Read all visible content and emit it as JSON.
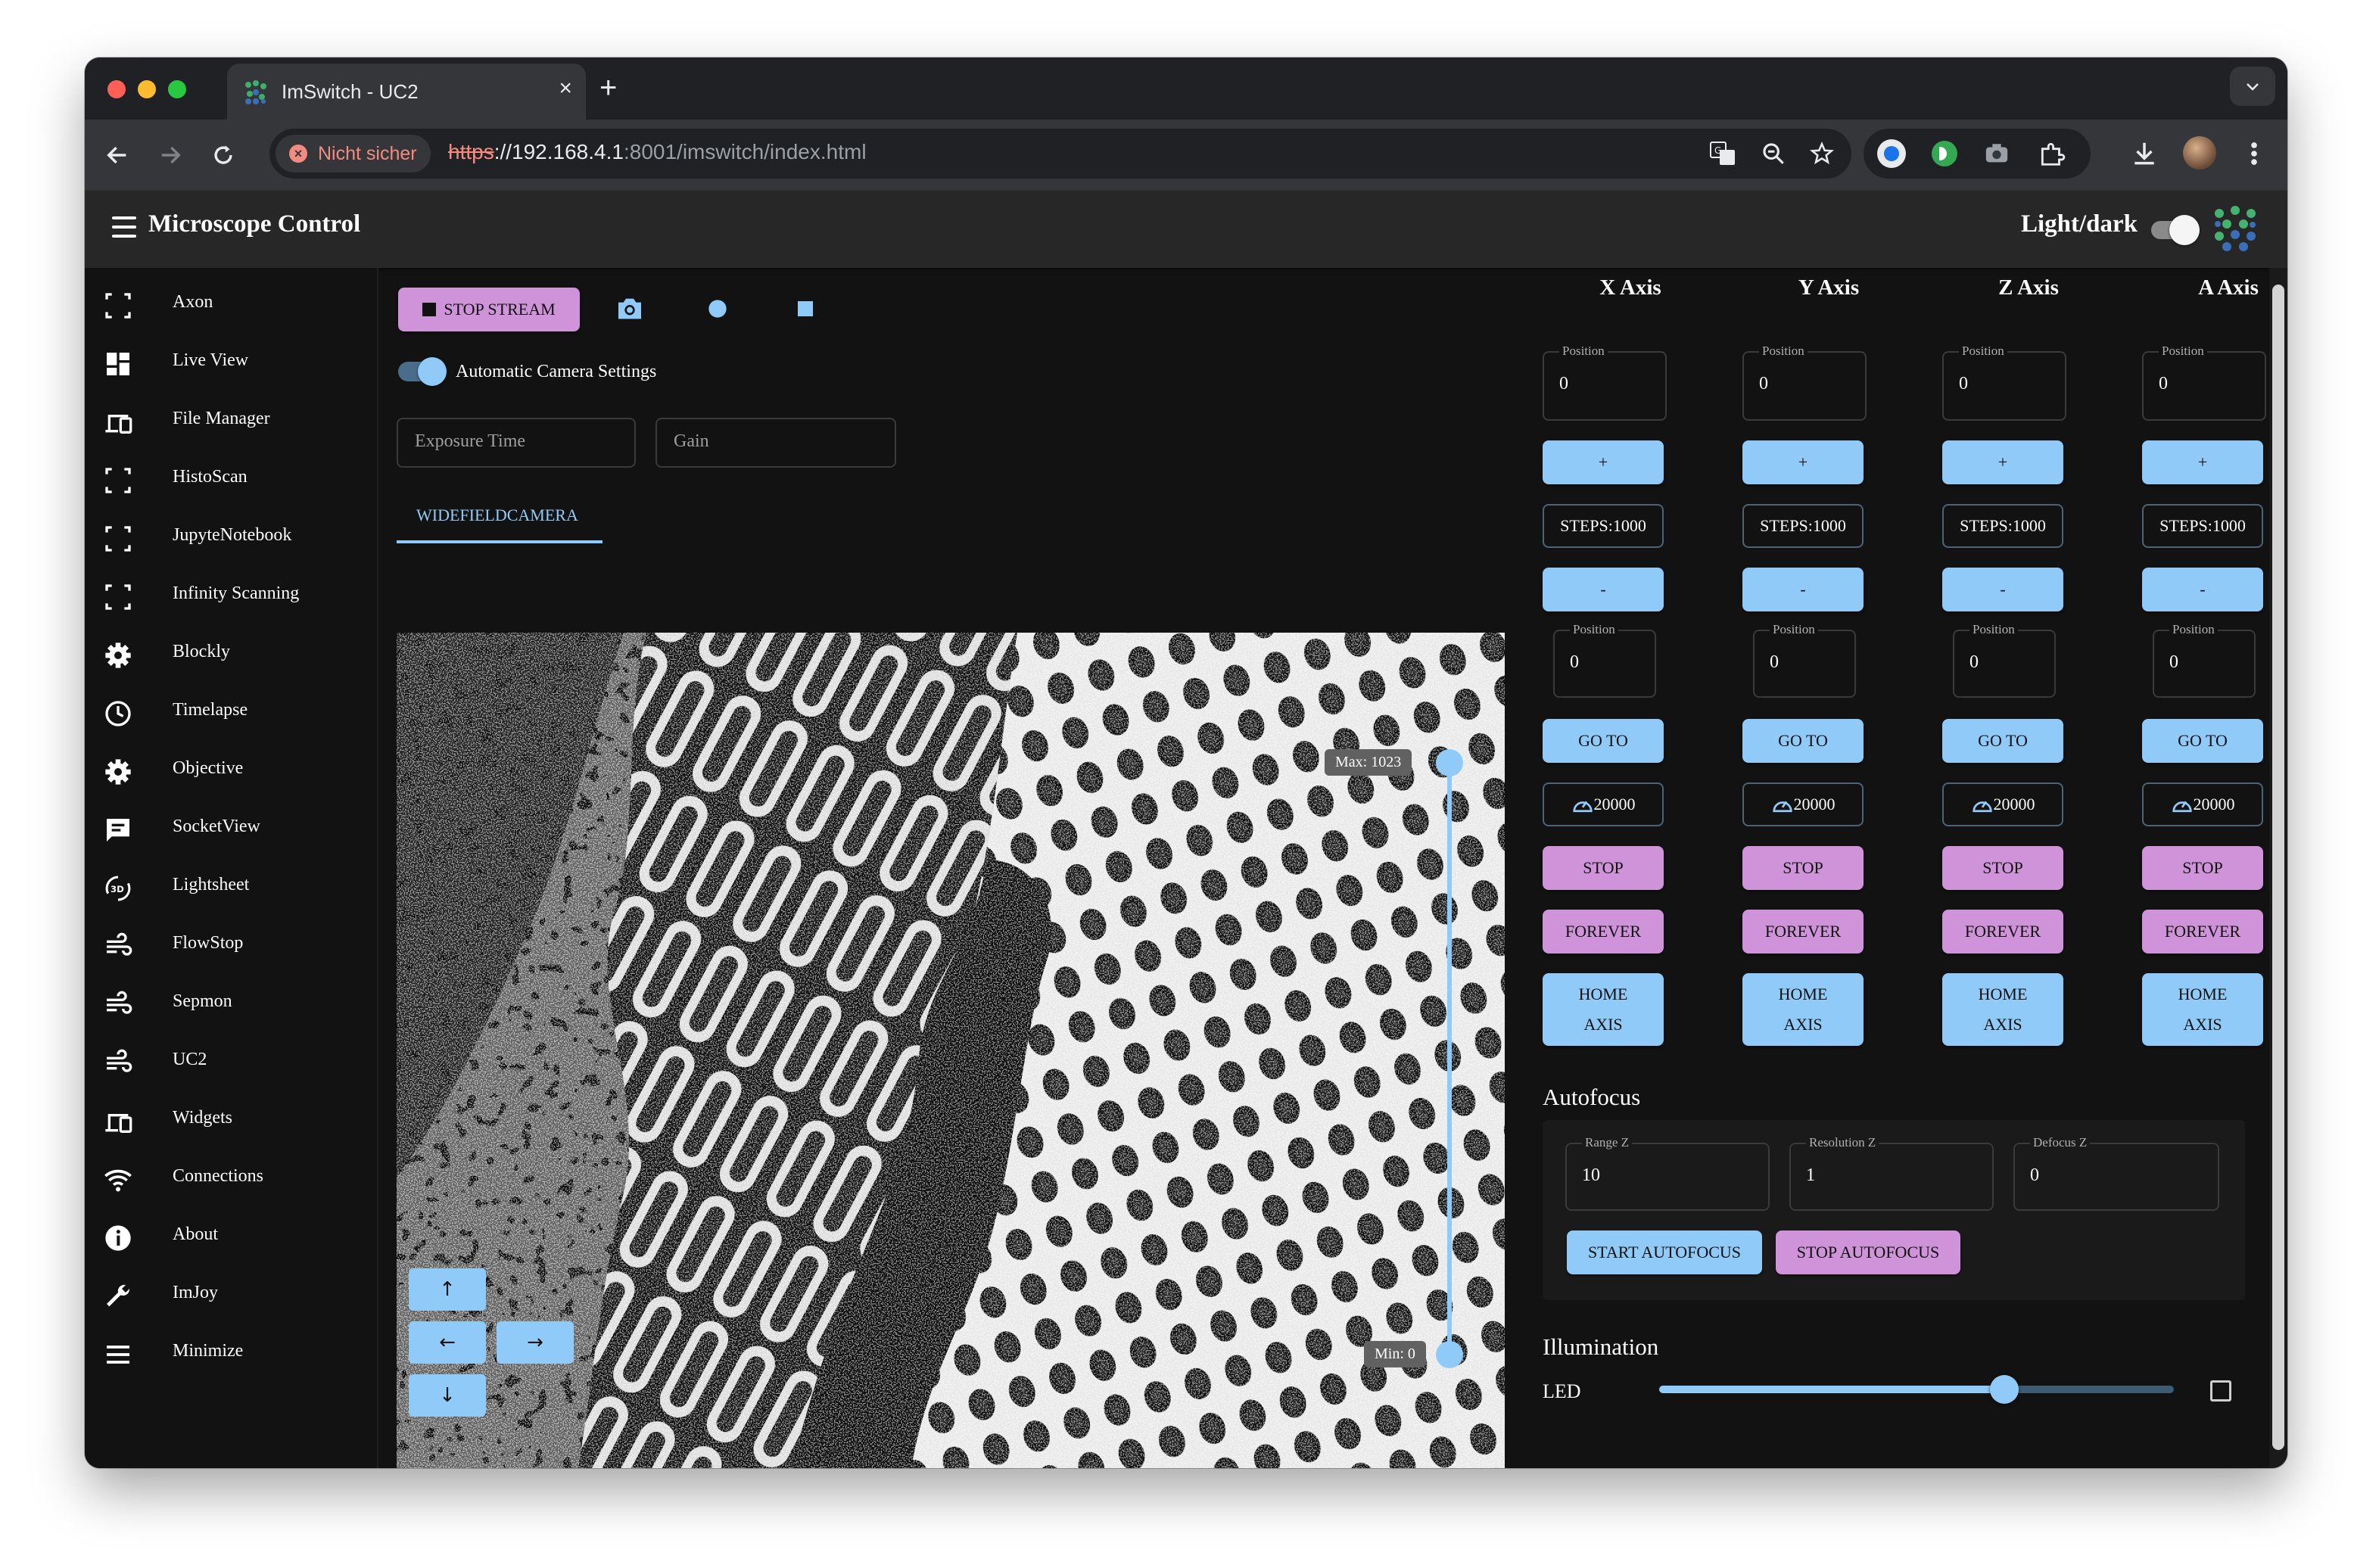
{
  "browser": {
    "tab_title": "ImSwitch - UC2",
    "tab_close": "×",
    "new_tab": "+",
    "not_secure_label": "Nicht sicher",
    "url_scheme": "https",
    "url_host": "://192.168.4.1",
    "url_rest": ":8001/imswitch/index.html"
  },
  "app": {
    "title": "Microscope Control",
    "theme_toggle_label": "Light/dark"
  },
  "sidebar": {
    "items": [
      {
        "label": "Axon",
        "icon": "crop-free-icon"
      },
      {
        "label": "Live View",
        "icon": "dashboard-icon"
      },
      {
        "label": "File Manager",
        "icon": "devices-icon"
      },
      {
        "label": "HistoScan",
        "icon": "crop-free-icon"
      },
      {
        "label": "JupyteNotebook",
        "icon": "crop-free-icon"
      },
      {
        "label": "Infinity Scanning",
        "icon": "crop-free-icon"
      },
      {
        "label": "Blockly",
        "icon": "settings-icon"
      },
      {
        "label": "Timelapse",
        "icon": "clock-icon"
      },
      {
        "label": "Objective",
        "icon": "settings-icon"
      },
      {
        "label": "SocketView",
        "icon": "message-icon"
      },
      {
        "label": "Lightsheet",
        "icon": "rotate-3d-icon"
      },
      {
        "label": "FlowStop",
        "icon": "air-icon"
      },
      {
        "label": "Sepmon",
        "icon": "air-icon"
      },
      {
        "label": "UC2",
        "icon": "air-icon"
      },
      {
        "label": "Widgets",
        "icon": "devices-icon"
      },
      {
        "label": "Connections",
        "icon": "wifi-icon"
      },
      {
        "label": "About",
        "icon": "info-icon"
      },
      {
        "label": "ImJoy",
        "icon": "wrench-icon"
      },
      {
        "label": "Minimize",
        "icon": "menu-icon"
      }
    ]
  },
  "camera": {
    "stop_stream_label": "STOP STREAM",
    "auto_settings_label": "Automatic Camera Settings",
    "auto_settings_enabled": true,
    "exposure_placeholder": "Exposure Time",
    "gain_placeholder": "Gain",
    "tab_label": "WIDEFIELDCAMERA",
    "range_max_label": "Max: 1023",
    "range_min_label": "Min: 0",
    "range_max": 1023,
    "range_min": 0,
    "arrows": {
      "up": "↑",
      "left": "←",
      "right": "→",
      "down": "↓"
    }
  },
  "axes": [
    {
      "name": "X Axis",
      "position_label": "Position",
      "position": "0",
      "plus": "+",
      "steps": "STEPS:1000",
      "minus": "-",
      "goto_position_label": "Position",
      "goto_position": "0",
      "goto": "GO TO",
      "speed": "20000",
      "stop": "STOP",
      "forever": "FOREVER",
      "home": "HOME AXIS"
    },
    {
      "name": "Y Axis",
      "position_label": "Position",
      "position": "0",
      "plus": "+",
      "steps": "STEPS:1000",
      "minus": "-",
      "goto_position_label": "Position",
      "goto_position": "0",
      "goto": "GO TO",
      "speed": "20000",
      "stop": "STOP",
      "forever": "FOREVER",
      "home": "HOME AXIS"
    },
    {
      "name": "Z Axis",
      "position_label": "Position",
      "position": "0",
      "plus": "+",
      "steps": "STEPS:1000",
      "minus": "-",
      "goto_position_label": "Position",
      "goto_position": "0",
      "goto": "GO TO",
      "speed": "20000",
      "stop": "STOP",
      "forever": "FOREVER",
      "home": "HOME AXIS"
    },
    {
      "name": "A Axis",
      "position_label": "Position",
      "position": "0",
      "plus": "+",
      "steps": "STEPS:1000",
      "minus": "-",
      "goto_position_label": "Position",
      "goto_position": "0",
      "goto": "GO TO",
      "speed": "20000",
      "stop": "STOP",
      "forever": "FOREVER",
      "home": "HOME AXIS"
    }
  ],
  "autofocus": {
    "title": "Autofocus",
    "range_label": "Range Z",
    "range_value": "10",
    "resolution_label": "Resolution Z",
    "resolution_value": "1",
    "defocus_label": "Defocus Z",
    "defocus_value": "0",
    "start_label": "START AUTOFOCUS",
    "stop_label": "STOP AUTOFOCUS"
  },
  "illumination": {
    "title": "Illumination",
    "led_label": "LED",
    "led_level_fraction": 0.67,
    "led_checked": false
  },
  "colors": {
    "accent_blue": "#90caf9",
    "accent_pink": "#ce93d8",
    "background": "#121212",
    "appbar": "#272727"
  }
}
